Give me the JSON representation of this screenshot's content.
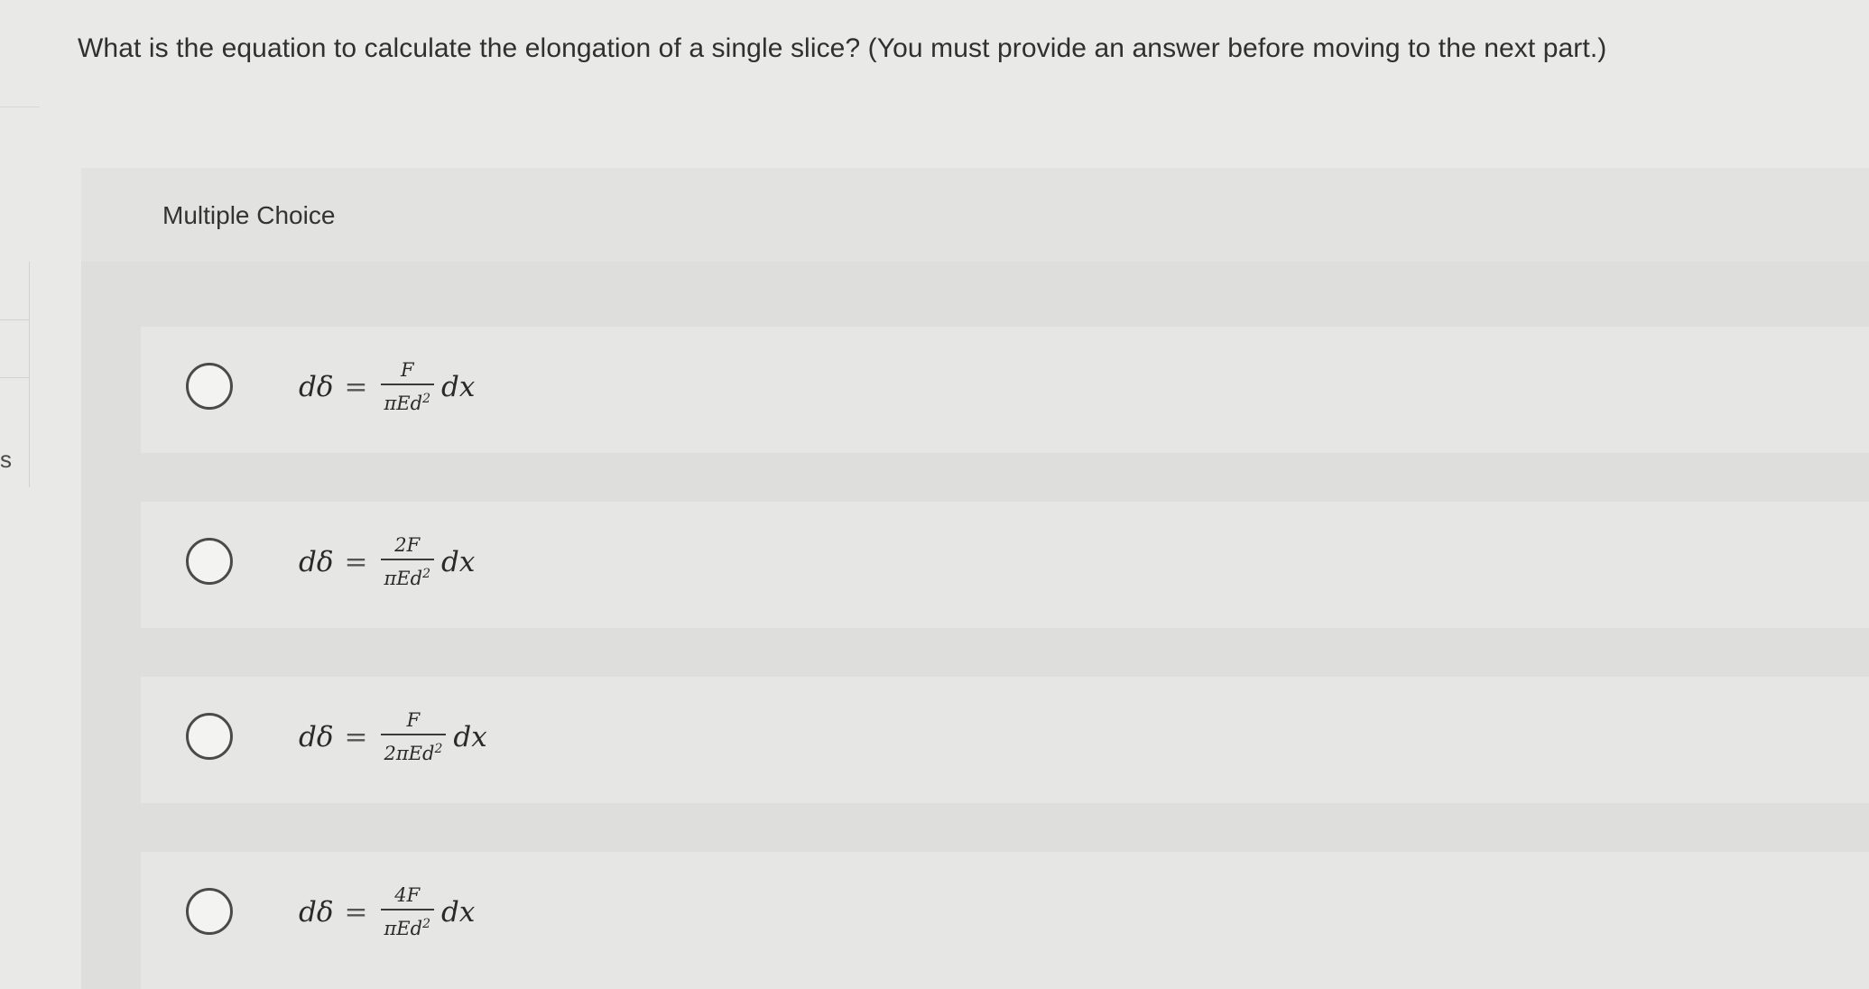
{
  "question": {
    "text": "What is the equation to calculate the elongation of a single slice? (You must provide an answer before moving to the next part.)"
  },
  "sidebar": {
    "partial_label": "s"
  },
  "multiple_choice": {
    "label": "Multiple Choice",
    "options": [
      {
        "lhs": "dδ",
        "equals": "=",
        "numerator": "F",
        "denominator": "πEd",
        "exponent": "2",
        "rhs": "dx",
        "selected": false
      },
      {
        "lhs": "dδ",
        "equals": "=",
        "numerator": "2F",
        "denominator": "πEd",
        "exponent": "2",
        "rhs": "dx",
        "selected": false
      },
      {
        "lhs": "dδ",
        "equals": "=",
        "numerator": "F",
        "denominator": "2πEd",
        "exponent": "2",
        "rhs": "dx",
        "selected": false
      },
      {
        "lhs": "dδ",
        "equals": "=",
        "numerator": "4F",
        "denominator": "πEd",
        "exponent": "2",
        "rhs": "dx",
        "selected": false
      }
    ]
  }
}
